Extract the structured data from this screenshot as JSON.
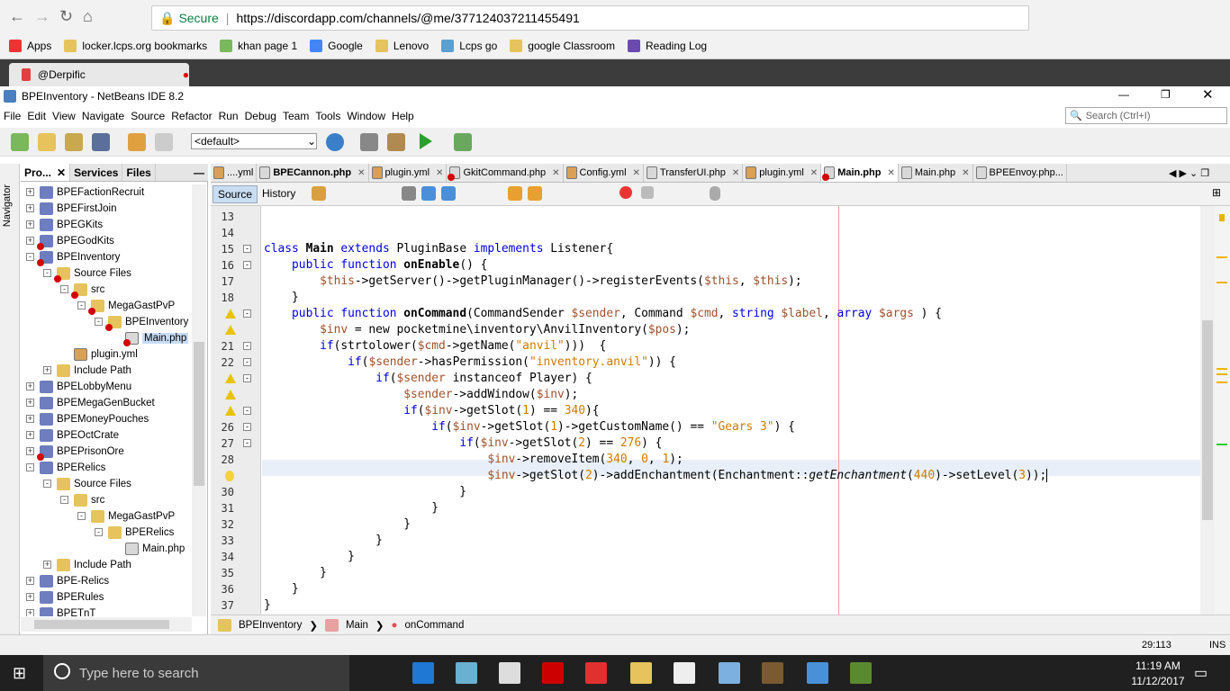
{
  "browser": {
    "secure_label": "Secure",
    "url": "https://discordapp.com/channels/@me/377124037211455491",
    "tab_title": "@Derpific",
    "bookmarks": [
      "Apps",
      "locker.lcps.org bookmarks",
      "khan page 1",
      "Google",
      "Lenovo",
      "Lcps go",
      "google Classroom",
      "Reading Log"
    ]
  },
  "ide": {
    "title": "BPEInventory - NetBeans IDE 8.2",
    "menu": [
      "File",
      "Edit",
      "View",
      "Navigate",
      "Source",
      "Refactor",
      "Run",
      "Debug",
      "Team",
      "Tools",
      "Window",
      "Help"
    ],
    "search_placeholder": "Search (Ctrl+I)",
    "config": "<default>"
  },
  "left_panel": {
    "navigator_label": "Navigator",
    "tabs": [
      "Pro...",
      "Services",
      "Files"
    ],
    "tree": [
      {
        "label": "BPEFactionRecruit",
        "level": 0,
        "icon": "php-project",
        "error": false,
        "exp": "+"
      },
      {
        "label": "BPEFirstJoin",
        "level": 0,
        "icon": "php-project",
        "error": false,
        "exp": "+"
      },
      {
        "label": "BPEGKits",
        "level": 0,
        "icon": "php-project",
        "error": false,
        "exp": "+"
      },
      {
        "label": "BPEGodKits",
        "level": 0,
        "icon": "php-project",
        "error": true,
        "exp": "+"
      },
      {
        "label": "BPEInventory",
        "level": 0,
        "icon": "php-project",
        "error": true,
        "exp": "-"
      },
      {
        "label": "Source Files",
        "level": 1,
        "icon": "folder",
        "error": true,
        "exp": "-"
      },
      {
        "label": "src",
        "level": 2,
        "icon": "folder",
        "error": true,
        "exp": "-"
      },
      {
        "label": "MegaGastPvP",
        "level": 3,
        "icon": "folder",
        "error": true,
        "exp": "-"
      },
      {
        "label": "BPEInventory",
        "level": 4,
        "icon": "folder",
        "error": true,
        "exp": "-"
      },
      {
        "label": "Main.php",
        "level": 5,
        "icon": "php-file",
        "error": true,
        "exp": "",
        "selected": true
      },
      {
        "label": "plugin.yml",
        "level": 2,
        "icon": "yml-file",
        "error": false,
        "exp": ""
      },
      {
        "label": "Include Path",
        "level": 1,
        "icon": "folder",
        "error": false,
        "exp": "+"
      },
      {
        "label": "BPELobbyMenu",
        "level": 0,
        "icon": "php-project",
        "error": false,
        "exp": "+"
      },
      {
        "label": "BPEMegaGenBucket",
        "level": 0,
        "icon": "php-project",
        "error": false,
        "exp": "+"
      },
      {
        "label": "BPEMoneyPouches",
        "level": 0,
        "icon": "php-project",
        "error": false,
        "exp": "+"
      },
      {
        "label": "BPEOctCrate",
        "level": 0,
        "icon": "php-project",
        "error": false,
        "exp": "+"
      },
      {
        "label": "BPEPrisonOre",
        "level": 0,
        "icon": "php-project",
        "error": true,
        "exp": "+"
      },
      {
        "label": "BPERelics",
        "level": 0,
        "icon": "php-project",
        "error": false,
        "exp": "-"
      },
      {
        "label": "Source Files",
        "level": 1,
        "icon": "folder",
        "error": false,
        "exp": "-"
      },
      {
        "label": "src",
        "level": 2,
        "icon": "folder",
        "error": false,
        "exp": "-"
      },
      {
        "label": "MegaGastPvP",
        "level": 3,
        "icon": "folder",
        "error": false,
        "exp": "-"
      },
      {
        "label": "BPERelics",
        "level": 4,
        "icon": "folder",
        "error": false,
        "exp": "-"
      },
      {
        "label": "Main.php",
        "level": 5,
        "icon": "php-file",
        "error": false,
        "exp": ""
      },
      {
        "label": "Include Path",
        "level": 1,
        "icon": "folder",
        "error": false,
        "exp": "+"
      },
      {
        "label": "BPE-Relics",
        "level": 0,
        "icon": "php-project",
        "error": false,
        "exp": "+"
      },
      {
        "label": "BPERules",
        "level": 0,
        "icon": "php-project",
        "error": false,
        "exp": "+"
      },
      {
        "label": "BPETnT",
        "level": 0,
        "icon": "php-project",
        "error": false,
        "exp": "+"
      }
    ]
  },
  "editor": {
    "tabs": [
      {
        "label": "....yml",
        "icon": "yml"
      },
      {
        "label": "BPECannon.php",
        "icon": "php",
        "bold": true
      },
      {
        "label": "plugin.yml",
        "icon": "yml"
      },
      {
        "label": "GkitCommand.php",
        "icon": "php-error"
      },
      {
        "label": "Config.yml",
        "icon": "yml"
      },
      {
        "label": "TransferUI.php",
        "icon": "php"
      },
      {
        "label": "plugin.yml",
        "icon": "yml"
      },
      {
        "label": "Main.php",
        "icon": "php-error",
        "active": true
      },
      {
        "label": "Main.php",
        "icon": "php"
      },
      {
        "label": "BPEEnvoy.php...",
        "icon": "php"
      }
    ],
    "source_label": "Source",
    "history_label": "History",
    "lines": [
      {
        "n": "13",
        "t": []
      },
      {
        "n": "14",
        "t": []
      },
      {
        "n": "15",
        "fold": "-",
        "t": [
          [
            "kw",
            "class "
          ],
          [
            "b",
            "Main "
          ],
          [
            "kw",
            "extends "
          ],
          [
            "",
            "PluginBase "
          ],
          [
            "kw",
            "implements "
          ],
          [
            "",
            "Listener{"
          ]
        ]
      },
      {
        "n": "16",
        "fold": "-",
        "t": [
          [
            "",
            "    "
          ],
          [
            "kw",
            "public function "
          ],
          [
            "b",
            "onEnable"
          ],
          [
            "",
            "() {"
          ]
        ]
      },
      {
        "n": "17",
        "t": [
          [
            "",
            "        "
          ],
          [
            "var",
            "$this"
          ],
          [
            "",
            "->getServer()->getPluginManager()->registerEvents("
          ],
          [
            "var",
            "$this"
          ],
          [
            "",
            ", "
          ],
          [
            "var",
            "$this"
          ],
          [
            "",
            ");"
          ]
        ]
      },
      {
        "n": "18",
        "t": [
          [
            "",
            "    }"
          ]
        ]
      },
      {
        "n": "",
        "warn": true,
        "fold": "-",
        "t": [
          [
            "",
            "    "
          ],
          [
            "kw",
            "public function "
          ],
          [
            "b",
            "onCommand"
          ],
          [
            "",
            "(CommandSender "
          ],
          [
            "var",
            "$sender"
          ],
          [
            "",
            ", Command "
          ],
          [
            "var",
            "$cmd"
          ],
          [
            "",
            ", "
          ],
          [
            "kw",
            "string "
          ],
          [
            "var",
            "$label"
          ],
          [
            "",
            ", "
          ],
          [
            "kw",
            "array "
          ],
          [
            "var",
            "$args"
          ],
          [
            "",
            " ) {"
          ]
        ]
      },
      {
        "n": "",
        "warn": true,
        "t": [
          [
            "",
            "        "
          ],
          [
            "var",
            "$inv"
          ],
          [
            "",
            " = new pocketmine\\inventory\\AnvilInventory("
          ],
          [
            "var",
            "$pos"
          ],
          [
            "",
            ");"
          ]
        ]
      },
      {
        "n": "21",
        "fold": "-",
        "t": [
          [
            "",
            "        "
          ],
          [
            "kw",
            "if"
          ],
          [
            "",
            "(strtolower("
          ],
          [
            "var",
            "$cmd"
          ],
          [
            "",
            "->getName("
          ],
          [
            "str",
            "\"anvil\""
          ],
          [
            "",
            ")))  {"
          ]
        ]
      },
      {
        "n": "22",
        "fold": "-",
        "t": [
          [
            "",
            "            "
          ],
          [
            "kw",
            "if"
          ],
          [
            "",
            "("
          ],
          [
            "var",
            "$sender"
          ],
          [
            "",
            "->hasPermission("
          ],
          [
            "str",
            "\"inventory.anvil\""
          ],
          [
            "",
            ")) {"
          ]
        ]
      },
      {
        "n": "",
        "warn": true,
        "fold": "-",
        "t": [
          [
            "",
            "                "
          ],
          [
            "kw",
            "if"
          ],
          [
            "",
            "("
          ],
          [
            "var",
            "$sender"
          ],
          [
            "",
            " instanceof Player) {"
          ]
        ]
      },
      {
        "n": "",
        "warn": true,
        "t": [
          [
            "",
            "                    "
          ],
          [
            "var",
            "$sender"
          ],
          [
            "",
            "->addWindow("
          ],
          [
            "var",
            "$inv"
          ],
          [
            "",
            ");"
          ]
        ]
      },
      {
        "n": "",
        "warn": true,
        "fold": "-",
        "t": [
          [
            "",
            "                    "
          ],
          [
            "kw",
            "if"
          ],
          [
            "",
            "("
          ],
          [
            "var",
            "$inv"
          ],
          [
            "",
            "->getSlot("
          ],
          [
            "num",
            "1"
          ],
          [
            "",
            ") == "
          ],
          [
            "num",
            "340"
          ],
          [
            "",
            "){"
          ]
        ]
      },
      {
        "n": "26",
        "fold": "-",
        "t": [
          [
            "",
            "                        "
          ],
          [
            "kw",
            "if"
          ],
          [
            "",
            "("
          ],
          [
            "var",
            "$inv"
          ],
          [
            "",
            "->getSlot("
          ],
          [
            "num",
            "1"
          ],
          [
            "",
            ")->getCustomName() == "
          ],
          [
            "str",
            "\"Gears 3\""
          ],
          [
            "",
            ") {"
          ]
        ]
      },
      {
        "n": "27",
        "fold": "-",
        "t": [
          [
            "",
            "                            "
          ],
          [
            "kw",
            "if"
          ],
          [
            "",
            "("
          ],
          [
            "var",
            "$inv"
          ],
          [
            "",
            "->getSlot("
          ],
          [
            "num",
            "2"
          ],
          [
            "",
            ") == "
          ],
          [
            "num",
            "276"
          ],
          [
            "",
            ") {"
          ]
        ]
      },
      {
        "n": "28",
        "t": [
          [
            "",
            "                                "
          ],
          [
            "var",
            "$inv"
          ],
          [
            "",
            "->removeItem("
          ],
          [
            "num",
            "340"
          ],
          [
            "",
            ", "
          ],
          [
            "num",
            "0"
          ],
          [
            "",
            ", "
          ],
          [
            "num",
            "1"
          ],
          [
            "",
            ");"
          ]
        ]
      },
      {
        "n": "",
        "hint": true,
        "t": [
          [
            "",
            "                                "
          ],
          [
            "var",
            "$inv"
          ],
          [
            "",
            "->getSlot("
          ],
          [
            "num",
            "2"
          ],
          [
            "",
            ")->addEnchantment(Enchantment::"
          ],
          [
            "it",
            "getEnchantment"
          ],
          [
            "",
            "("
          ],
          [
            "num",
            "440"
          ],
          [
            "",
            ")->setLevel("
          ],
          [
            "num",
            "3"
          ],
          [
            "",
            "));"
          ]
        ]
      },
      {
        "n": "30",
        "t": [
          [
            "",
            "                            }"
          ]
        ]
      },
      {
        "n": "31",
        "t": [
          [
            "",
            "                        }"
          ]
        ]
      },
      {
        "n": "32",
        "t": [
          [
            "",
            "                    }"
          ]
        ]
      },
      {
        "n": "33",
        "t": [
          [
            "",
            "                }"
          ]
        ]
      },
      {
        "n": "34",
        "t": [
          [
            "",
            "            }"
          ]
        ]
      },
      {
        "n": "35",
        "t": [
          [
            "",
            "        }"
          ]
        ]
      },
      {
        "n": "36",
        "t": [
          [
            "",
            "    }"
          ]
        ]
      },
      {
        "n": "37",
        "t": [
          [
            "",
            "}"
          ]
        ]
      }
    ],
    "breadcrumb": [
      "BPEInventory",
      "Main",
      "onCommand"
    ]
  },
  "status": {
    "position": "29:113",
    "mode": "INS"
  },
  "taskbar": {
    "search_placeholder": "Type here to search",
    "time": "11:19 AM",
    "date": "11/12/2017"
  }
}
